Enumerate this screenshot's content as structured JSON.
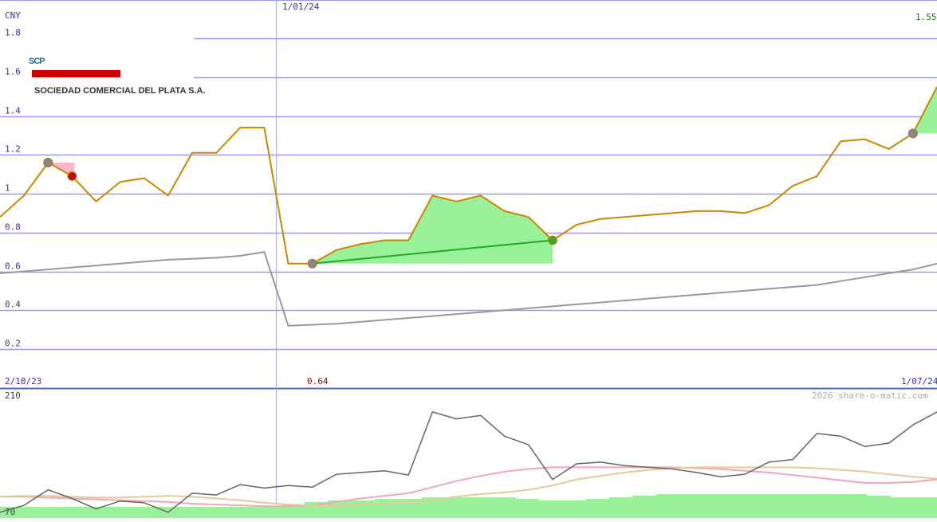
{
  "header": {
    "currency": "CNY",
    "top_date": "1/01/24",
    "last_price_label": "1.55"
  },
  "logo": {
    "text": "SCP",
    "company": "SOCIEDAD COMERCIAL DEL PLATA S.A."
  },
  "footer": {
    "start_date": "2/10/23",
    "cursor_value": "0.64",
    "end_date": "1/07/24",
    "watermark": "2026 share-o-matic.com"
  },
  "colors": {
    "price": "#cc8800",
    "moving_average": "#999999",
    "gridline": "#9999ee",
    "cursor_line": "#aaaaee",
    "green_fill": "#99f199",
    "green_line": "#22aa22",
    "pink_fill": "#ffb6c8",
    "red_marker": "#bb1111",
    "indicator_black": "#666666",
    "indicator_pink": "#f4a6b8",
    "indicator_tan": "#e8c89a",
    "volume": "#99f199",
    "axis_text": "#3333aa",
    "logo_blue": "#2a6e9e",
    "logo_red": "#cc0000"
  },
  "chart_data": [
    {
      "type": "line",
      "title": "",
      "ylabel": "CNY",
      "ylim": [
        0.1,
        1.85
      ],
      "y_ticks": [
        0.2,
        0.4,
        0.6,
        0.8,
        1,
        1.2,
        1.4,
        1.6,
        1.8
      ],
      "y_tick_labels": [
        "0.2",
        "0.4",
        "0.6",
        "0.8",
        "1",
        "1.2",
        "1.4",
        "1.6",
        "1.8"
      ],
      "x_labels": [
        "2/10/23",
        "1/01/24",
        "1/07/24"
      ],
      "grid": true,
      "series": [
        {
          "role": "price",
          "values": [
            0.88,
            0.99,
            1.16,
            1.09,
            0.96,
            1.06,
            1.08,
            0.99,
            1.21,
            1.21,
            1.34,
            1.34,
            0.64,
            0.64,
            0.71,
            0.74,
            0.76,
            0.76,
            0.99,
            0.96,
            0.99,
            0.91,
            0.88,
            0.76,
            0.84,
            0.87,
            0.88,
            0.89,
            0.9,
            0.91,
            0.91,
            0.9,
            0.94,
            1.04,
            1.09,
            1.27,
            1.28,
            1.23,
            1.31,
            1.55
          ]
        },
        {
          "role": "moving_average",
          "values": [
            0.59,
            0.6,
            0.61,
            0.62,
            0.63,
            0.64,
            0.65,
            0.66,
            0.665,
            0.67,
            0.68,
            0.7,
            0.32,
            0.325,
            0.33,
            0.34,
            0.35,
            0.36,
            0.37,
            0.38,
            0.39,
            0.4,
            0.41,
            0.42,
            0.43,
            0.44,
            0.45,
            0.46,
            0.47,
            0.48,
            0.49,
            0.5,
            0.51,
            0.52,
            0.53,
            0.55,
            0.57,
            0.59,
            0.61,
            0.64
          ]
        }
      ],
      "annotations": {
        "cursor_date": "1/01/24",
        "cursor_index": 11.5,
        "pink_area": {
          "from_index": 2,
          "to_index": 3
        },
        "green_area": {
          "from_index": 13,
          "to_index": 23,
          "trend_from": 0.64,
          "trend_to": 0.76
        },
        "green_tail": {
          "from_index": 38,
          "to_index": 39
        },
        "markers": [
          {
            "index": 2,
            "value": 1.16,
            "kind": "grey"
          },
          {
            "index": 3,
            "value": 1.09,
            "kind": "red"
          },
          {
            "index": 13,
            "value": 0.64,
            "kind": "grey"
          },
          {
            "index": 23,
            "value": 0.76,
            "kind": "green"
          },
          {
            "index": 38,
            "value": 1.31,
            "kind": "grey"
          }
        ]
      }
    },
    {
      "type": "line",
      "title": "",
      "ylim": [
        70,
        210
      ],
      "y_tick_labels": [
        "210",
        "70"
      ],
      "series": [
        {
          "role": "indicator",
          "values": [
            72,
            80,
            98,
            88,
            76,
            85,
            83,
            72,
            94,
            92,
            104,
            100,
            103,
            101,
            116,
            118,
            120,
            115,
            188,
            180,
            184,
            160,
            150,
            110,
            128,
            130,
            126,
            124,
            122,
            118,
            113,
            116,
            130,
            133,
            163,
            160,
            148,
            152,
            173,
            188
          ]
        },
        {
          "role": "indicator_pink",
          "values": [
            90,
            90,
            89,
            88,
            87,
            86,
            85,
            84,
            82,
            81,
            80,
            79,
            79,
            80,
            84,
            88,
            91,
            94,
            101,
            108,
            114,
            119,
            122,
            124,
            124,
            124,
            124,
            124,
            124,
            123,
            122,
            120,
            118,
            115,
            112,
            109,
            106,
            106,
            107,
            110
          ]
        },
        {
          "role": "indicator_tan",
          "values": [
            90,
            91,
            91,
            90,
            89,
            89,
            90,
            91,
            90,
            88,
            86,
            83,
            81,
            80,
            80,
            81,
            82,
            83,
            86,
            90,
            93,
            95,
            98,
            103,
            110,
            114,
            118,
            121,
            123,
            124,
            124,
            124,
            124,
            124,
            123,
            121,
            119,
            116,
            113,
            111
          ]
        }
      ],
      "volume": [
        14,
        14,
        14,
        14,
        14,
        14,
        14,
        14,
        14,
        14,
        14,
        14,
        16,
        20,
        22,
        22,
        24,
        24,
        26,
        26,
        26,
        26,
        24,
        22,
        22,
        24,
        26,
        28,
        30,
        30,
        30,
        30,
        30,
        30,
        30,
        30,
        30,
        28,
        26,
        26
      ]
    }
  ]
}
